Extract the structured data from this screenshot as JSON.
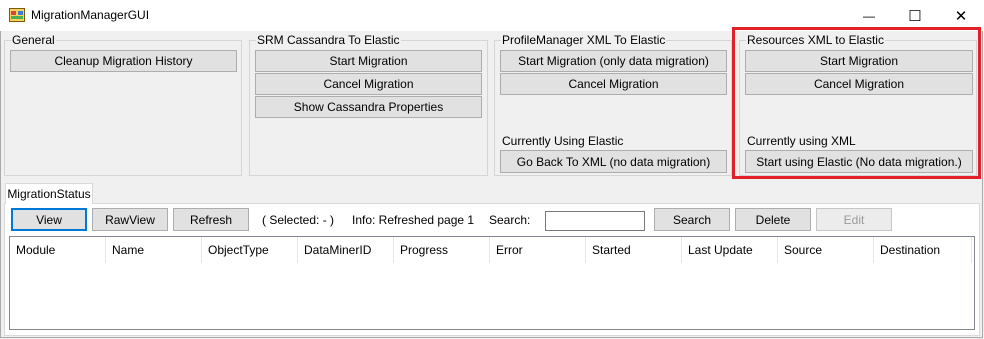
{
  "window": {
    "title": "MigrationManagerGUI",
    "minimize_glyph": "—",
    "maximize_glyph": "☐",
    "close_glyph": "✕"
  },
  "groups": {
    "general": {
      "title": "General",
      "cleanup_label": "Cleanup Migration History"
    },
    "srm": {
      "title": "SRM Cassandra To Elastic",
      "start_label": "Start Migration",
      "cancel_label": "Cancel Migration",
      "show_props_label": "Show Cassandra Properties"
    },
    "profile": {
      "title": "ProfileManager XML To Elastic",
      "start_label": "Start Migration (only data migration)",
      "cancel_label": "Cancel Migration",
      "status_text": "Currently Using Elastic",
      "back_label": "Go Back To XML (no data migration)"
    },
    "resources": {
      "title": "Resources XML to Elastic",
      "start_label": "Start Migration",
      "cancel_label": "Cancel Migration",
      "status_text": "Currently using XML",
      "use_elastic_label": "Start using Elastic (No data migration.)"
    }
  },
  "tabs": [
    {
      "label": "MigrationStatus"
    }
  ],
  "toolbar": {
    "view_label": "View",
    "rawview_label": "RawView",
    "refresh_label": "Refresh",
    "selected_text": "( Selected: - )",
    "info_text": "Info: Refreshed page 1",
    "search_label": "Search:",
    "search_value": "",
    "search_button": "Search",
    "delete_label": "Delete",
    "edit_label": "Edit"
  },
  "grid": {
    "columns": [
      "Module",
      "Name",
      "ObjectType",
      "DataMinerID",
      "Progress",
      "Error",
      "Started",
      "Last Update",
      "Source",
      "Destination"
    ],
    "rows": []
  },
  "colors": {
    "highlight": "#e3202a",
    "focus": "#0078d7"
  }
}
